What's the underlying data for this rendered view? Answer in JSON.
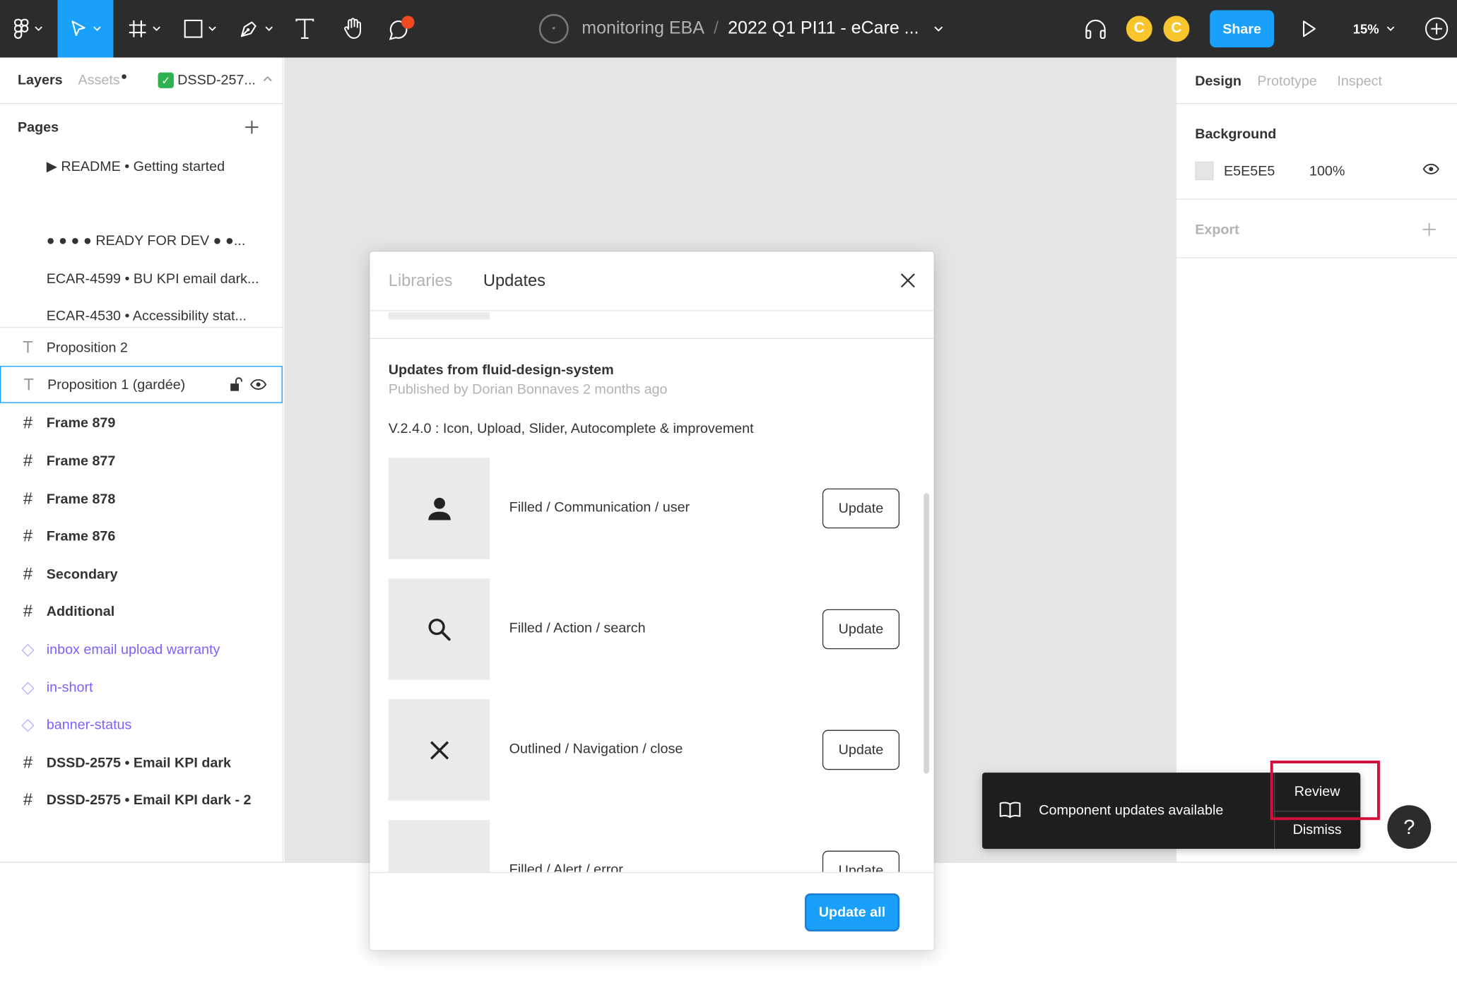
{
  "toolbar": {
    "project": "monitoring EBA",
    "file_title": "2022 Q1 PI11 - eCare ...",
    "avatars": [
      "C",
      "C"
    ],
    "share_label": "Share",
    "zoom": "15%",
    "accent": "#18a0fb",
    "tools": [
      "figma-menu-icon",
      "move-icon",
      "frame-icon",
      "rectangle-icon",
      "pen-icon",
      "text-icon",
      "hand-icon",
      "comment-icon"
    ]
  },
  "left_panel": {
    "tabs": {
      "layers": "Layers",
      "assets": "Assets",
      "branch": "DSSD-257..."
    },
    "pages_title": "Pages",
    "pages": [
      "▶ README • Getting started",
      "● ● ● ● READY FOR DEV ● ●...",
      "ECAR-4599 • BU KPI email dark...",
      "ECAR-4530 • Accessibility stat..."
    ],
    "layers": [
      {
        "label": "Proposition 2",
        "kind": "text"
      },
      {
        "label": "Proposition 1 (gardée)",
        "kind": "text"
      },
      {
        "label": "Frame 879",
        "kind": "frame"
      },
      {
        "label": "Frame 877",
        "kind": "frame"
      },
      {
        "label": "Frame 878",
        "kind": "frame"
      },
      {
        "label": "Frame 876",
        "kind": "frame"
      },
      {
        "label": "Secondary",
        "kind": "frame"
      },
      {
        "label": "Additional",
        "kind": "frame"
      },
      {
        "label": "inbox email upload warranty",
        "kind": "component"
      },
      {
        "label": "in-short",
        "kind": "component"
      },
      {
        "label": "banner-status",
        "kind": "component"
      },
      {
        "label": "DSSD-2575 • Email KPI dark",
        "kind": "frame"
      },
      {
        "label": "DSSD-2575 • Email KPI dark - 2",
        "kind": "frame"
      }
    ]
  },
  "right_panel": {
    "tabs": {
      "design": "Design",
      "prototype": "Prototype",
      "inspect": "Inspect"
    },
    "background_title": "Background",
    "bg_hex": "E5E5E5",
    "bg_opacity": "100%",
    "export_title": "Export"
  },
  "modal": {
    "tabs": {
      "libraries": "Libraries",
      "updates": "Updates"
    },
    "source_title": "Updates from fluid-design-system",
    "published": "Published by Dorian Bonnaves 2 months ago",
    "version_note": "V.2.4.0 : Icon, Upload, Slider, Autocomplete & improvement",
    "components": [
      {
        "name": "Filled / Communication / user",
        "icon": "user-icon"
      },
      {
        "name": "Filled / Action / search",
        "icon": "search-icon"
      },
      {
        "name": "Outlined / Navigation / close",
        "icon": "close-icon"
      },
      {
        "name": "Filled / Alert / error",
        "icon": "error-icon"
      }
    ],
    "update_label": "Update",
    "update_all_label": "Update all"
  },
  "toast": {
    "message": "Component updates available",
    "review_label": "Review",
    "dismiss_label": "Dismiss"
  },
  "help_label": "?"
}
